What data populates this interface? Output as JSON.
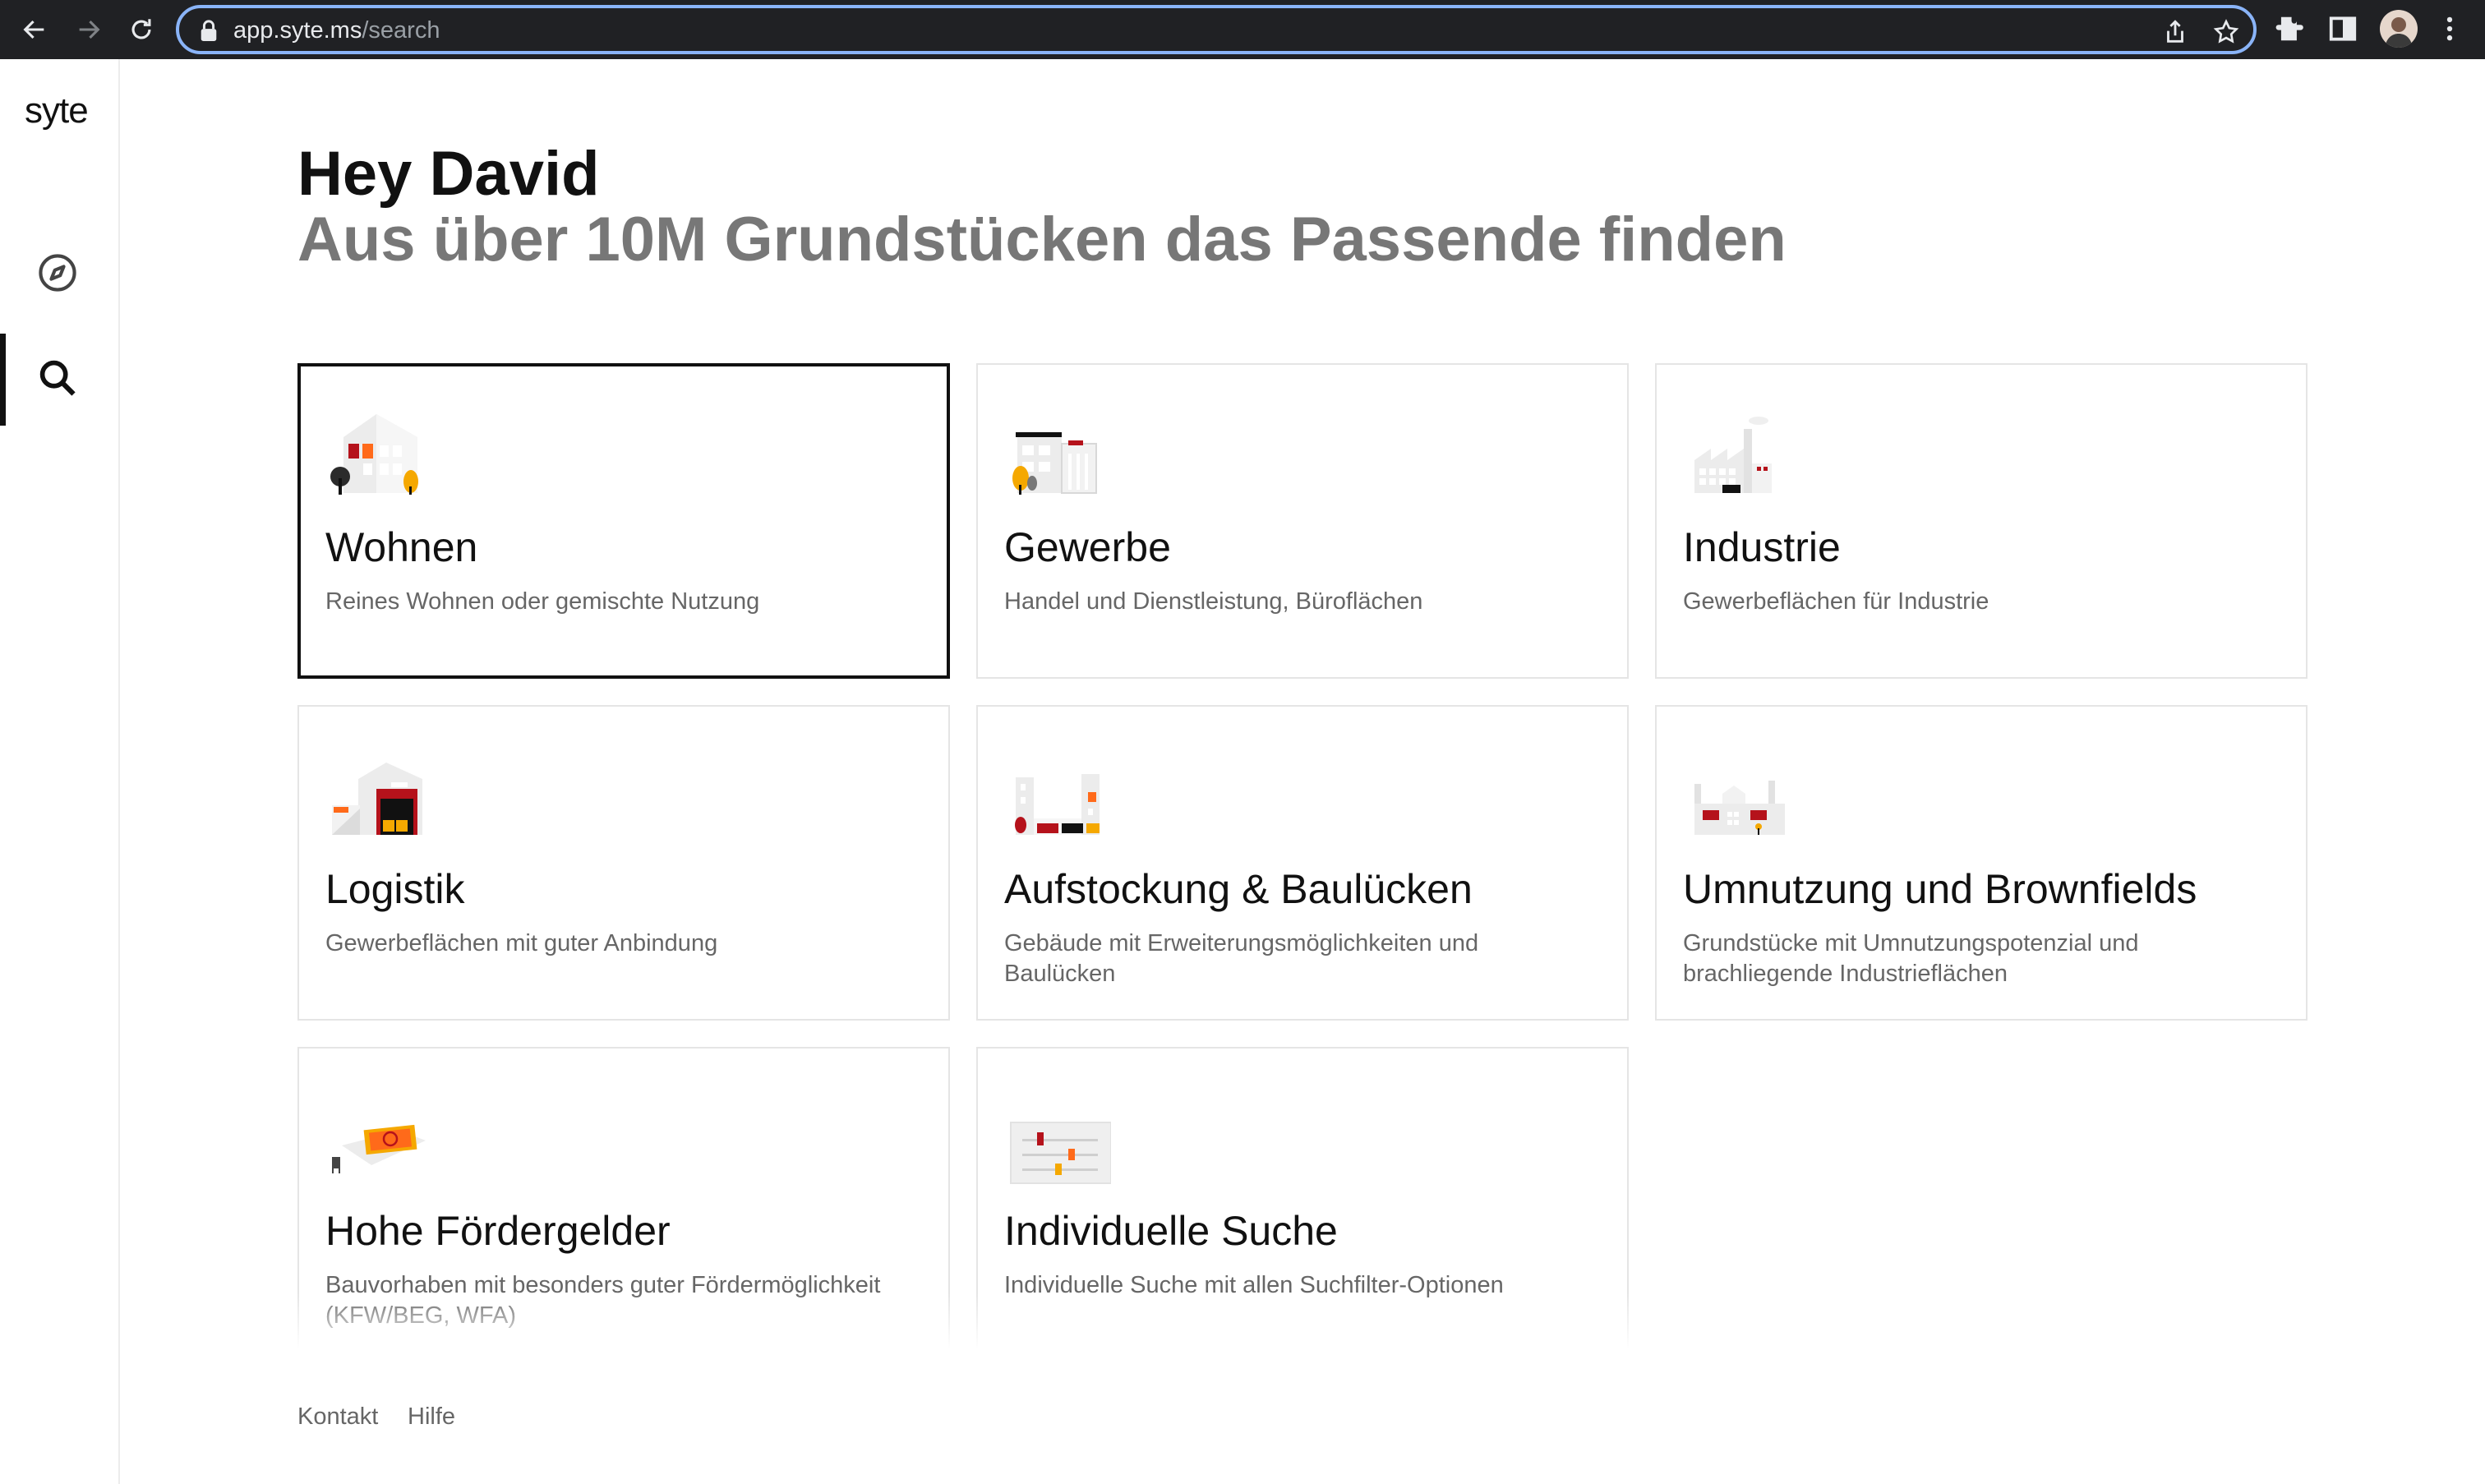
{
  "browser": {
    "url_host": "app.syte.ms",
    "url_path": "/search"
  },
  "sidebar": {
    "logo": "syte",
    "items": [
      {
        "icon": "compass-icon",
        "active": false
      },
      {
        "icon": "search-icon",
        "active": true
      }
    ]
  },
  "header": {
    "greeting": "Hey David",
    "subtitle": "Aus über 10M Grundstücken das Passende finden"
  },
  "categories": [
    {
      "title": "Wohnen",
      "description": "Reines Wohnen oder gemischte Nutzung",
      "selected": true,
      "icon": "residential-building-icon"
    },
    {
      "title": "Gewerbe",
      "description": "Handel und Dienstleistung, Büroflächen",
      "selected": false,
      "icon": "office-building-icon"
    },
    {
      "title": "Industrie",
      "description": "Gewerbeflächen für Industrie",
      "selected": false,
      "icon": "factory-icon"
    },
    {
      "title": "Logistik",
      "description": "Gewerbeflächen mit guter Anbindung",
      "selected": false,
      "icon": "warehouse-icon"
    },
    {
      "title": "Aufstockung & Baulücken",
      "description": "Gebäude mit Erweiterungsmöglichkeiten und Baulücken",
      "selected": false,
      "icon": "building-gap-icon"
    },
    {
      "title": "Umnutzung und Brownfields",
      "description": "Grundstücke mit Umnutzungspotenzial und brachliegende Industrieflächen",
      "selected": false,
      "icon": "brownfield-icon"
    },
    {
      "title": "Hohe Fördergelder",
      "description": "Bauvorhaben mit besonders guter Fördermöglichkeit (KFW/BEG, WFA)",
      "selected": false,
      "icon": "funding-money-icon"
    },
    {
      "title": "Individuelle Suche",
      "description": "Individuelle Suche mit allen Suchfilter-Optionen",
      "selected": false,
      "icon": "filter-sliders-icon"
    }
  ],
  "footer": {
    "contact": "Kontakt",
    "help": "Hilfe"
  },
  "colors": {
    "accent_orange": "#ff6a1a",
    "accent_yellow": "#f5a800",
    "accent_red": "#b5121b",
    "dark": "#111111"
  }
}
